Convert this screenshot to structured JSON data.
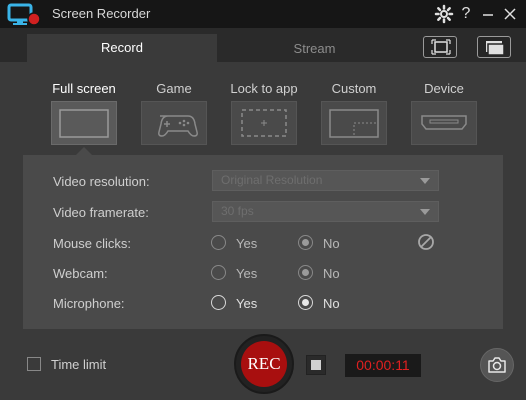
{
  "app": {
    "title": "Screen Recorder"
  },
  "titlebar": {
    "settings_icon": "gear-icon",
    "help_label": "?",
    "minimize_icon": "minimize-icon",
    "close_icon": "close-icon"
  },
  "tabs": [
    {
      "label": "Record",
      "active": true
    },
    {
      "label": "Stream",
      "active": false
    }
  ],
  "view_buttons": [
    {
      "icon": "fullscreen-view-icon"
    },
    {
      "icon": "window-view-icon"
    }
  ],
  "modes": [
    {
      "label": "Full screen",
      "active": true,
      "icon": "full-screen-icon"
    },
    {
      "label": "Game",
      "active": false,
      "icon": "gamepad-icon"
    },
    {
      "label": "Lock to app",
      "active": false,
      "icon": "lock-to-app-icon"
    },
    {
      "label": "Custom",
      "active": false,
      "icon": "custom-region-icon"
    },
    {
      "label": "Device",
      "active": false,
      "icon": "hdmi-device-icon"
    }
  ],
  "settings": {
    "video_resolution": {
      "label": "Video resolution:",
      "value": "Original Resolution"
    },
    "video_framerate": {
      "label": "Video framerate:",
      "value": "30 fps"
    },
    "mouse_clicks": {
      "label": "Mouse clicks:",
      "yes": "Yes",
      "no": "No",
      "selected": "No"
    },
    "webcam": {
      "label": "Webcam:",
      "yes": "Yes",
      "no": "No",
      "selected": "No"
    },
    "microphone": {
      "label": "Microphone:",
      "yes": "Yes",
      "no": "No",
      "selected": "No"
    }
  },
  "footer": {
    "time_limit_label": "Time limit",
    "time_limit_checked": false,
    "rec_label": "REC",
    "timer": "00:00:11",
    "camera_icon": "camera-icon"
  },
  "colors": {
    "rec_red": "#a80f0f",
    "timer_red": "#e02020",
    "background": "#3a3a3a"
  }
}
